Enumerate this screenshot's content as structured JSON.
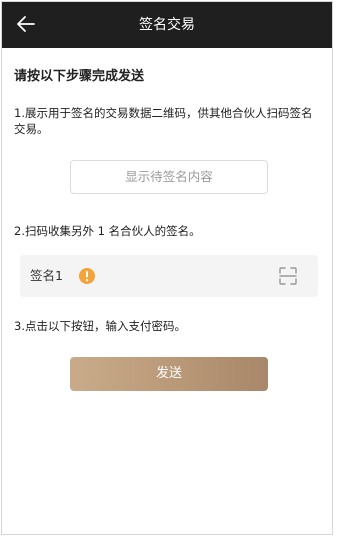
{
  "nav": {
    "title": "签名交易",
    "back_icon": "back-arrow-icon"
  },
  "content": {
    "heading": "请按以下步骤完成发送",
    "step1_text": "1.展示用于签名的交易数据二维码，供其他合伙人扫码签名交易。",
    "show_button_label": "显示待签名内容",
    "step2_text": "2.扫码收集另外 1 名合伙人的签名。",
    "signature": {
      "label": "签名1",
      "status_icon": "warning-icon",
      "status_color": "#f2a33a",
      "scan_icon": "scan-icon"
    },
    "step3_text": "3.点击以下按钮，输入支付密码。",
    "send_button_label": "发送"
  },
  "colors": {
    "nav_bg": "#1f1f1f",
    "accent_gold": "#b99877",
    "row_bg": "#f4f4f4"
  }
}
